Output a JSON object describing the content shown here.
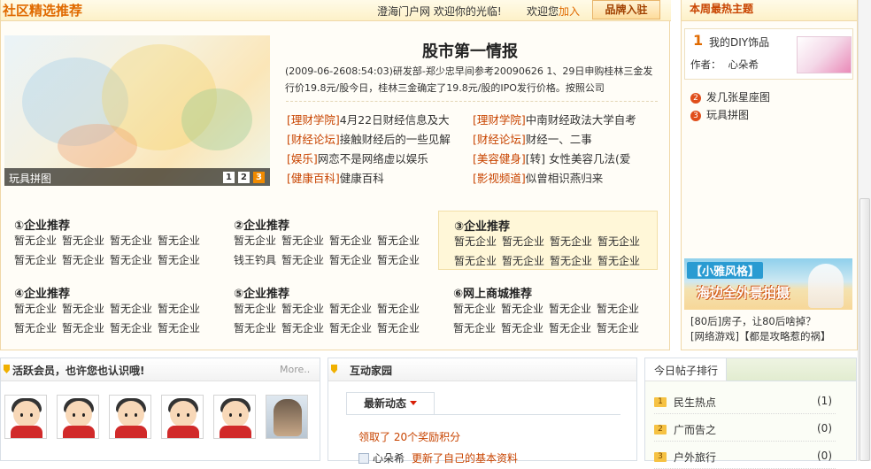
{
  "header": {
    "title": "社区精选推荐",
    "welcome": "澄海门户网 欢迎你的光临!",
    "login_prefix": "欢迎您",
    "login_link": "加入",
    "brand_button": "品牌入驻"
  },
  "slideshow": {
    "caption": "玩具拼图",
    "pages": [
      "1",
      "2",
      "3"
    ],
    "active_page": 3
  },
  "headline": {
    "title": "股市第一情报",
    "summary": "(2009-06-2608:54:03)研发部-郑少忠早间参考20090626 1、29日申购桂林三金发行价19.8元/股今日，桂林三金确定了19.8元/股的IPO发行价格。按照公司"
  },
  "news_links": [
    {
      "cat": "[理财学院]",
      "text": "4月22日财经信息及大"
    },
    {
      "cat": "[理财学院]",
      "text": "中南财经政法大学自考"
    },
    {
      "cat": "[财经论坛]",
      "text": "接触财经后的一些见解"
    },
    {
      "cat": "[财经论坛]",
      "text": "财经一、二事"
    },
    {
      "cat": "[娱乐]",
      "text": "网恋不是网络虚以娱乐"
    },
    {
      "cat": "[美容健身]",
      "text": "[转] 女性美容几法(爱"
    },
    {
      "cat": "[健康百科]",
      "text": "健康百科"
    },
    {
      "cat": "[影视频道]",
      "text": "似曾相识燕归来"
    }
  ],
  "recommend": [
    {
      "title": "①企业推荐",
      "rows": [
        [
          "暂无企业",
          "暂无企业",
          "暂无企业",
          "暂无企业"
        ],
        [
          "暂无企业",
          "暂无企业",
          "暂无企业",
          "暂无企业"
        ]
      ]
    },
    {
      "title": "②企业推荐",
      "rows": [
        [
          "暂无企业",
          "暂无企业",
          "暂无企业",
          "暂无企业"
        ],
        [
          "钱王钓具",
          "暂无企业",
          "暂无企业",
          "暂无企业"
        ]
      ]
    },
    {
      "title": "③企业推荐",
      "rows": [
        [
          "暂无企业",
          "暂无企业",
          "暂无企业",
          "暂无企业"
        ],
        [
          "暂无企业",
          "暂无企业",
          "暂无企业",
          "暂无企业"
        ]
      ]
    },
    {
      "title": "④企业推荐",
      "rows": [
        [
          "暂无企业",
          "暂无企业",
          "暂无企业",
          "暂无企业"
        ],
        [
          "暂无企业",
          "暂无企业",
          "暂无企业",
          "暂无企业"
        ]
      ]
    },
    {
      "title": "⑤企业推荐",
      "rows": [
        [
          "暂无企业",
          "暂无企业",
          "暂无企业",
          "暂无企业"
        ],
        [
          "暂无企业",
          "暂无企业",
          "暂无企业",
          "暂无企业"
        ]
      ]
    },
    {
      "title": "⑥网上商城推荐",
      "rows": [
        [
          "暂无企业",
          "暂无企业",
          "暂无企业",
          "暂无企业"
        ],
        [
          "暂无企业",
          "暂无企业",
          "暂无企业",
          "暂无企业"
        ]
      ]
    }
  ],
  "weekly_hot": {
    "title": "本周最热主题",
    "top": {
      "num": "1",
      "title": "我的DIY饰品",
      "author_label": "作者：",
      "author": "心朵希"
    },
    "items": [
      {
        "num": "2",
        "text": "发几张星座图"
      },
      {
        "num": "3",
        "text": "玩具拼图"
      }
    ],
    "banner_tag": "【小雅风格】",
    "banner_text": "海边全外景拍摄",
    "notes": [
      "[80后]房子，让80后啥掉？",
      "[网络游戏]【都是攻略惹的祸】"
    ]
  },
  "members": {
    "title": "活跃会员，也许您也认识哦!",
    "more": "More.."
  },
  "interact": {
    "title": "互动家园",
    "tab": "最新动态",
    "line1": "领取了 20个奖励积分",
    "line2_user": "心朵希",
    "line2_text": "更新了自己的基本资料"
  },
  "ranking": {
    "title": "今日帖子排行",
    "items": [
      {
        "num": "1",
        "label": "民生热点",
        "count": "(1)"
      },
      {
        "num": "2",
        "label": "广而告之",
        "count": "(0)"
      },
      {
        "num": "3",
        "label": "户外旅行",
        "count": "(0)"
      }
    ]
  },
  "colors": {
    "accent": "#e06a00",
    "category": "#c84400",
    "badge": "#e04e1b"
  }
}
